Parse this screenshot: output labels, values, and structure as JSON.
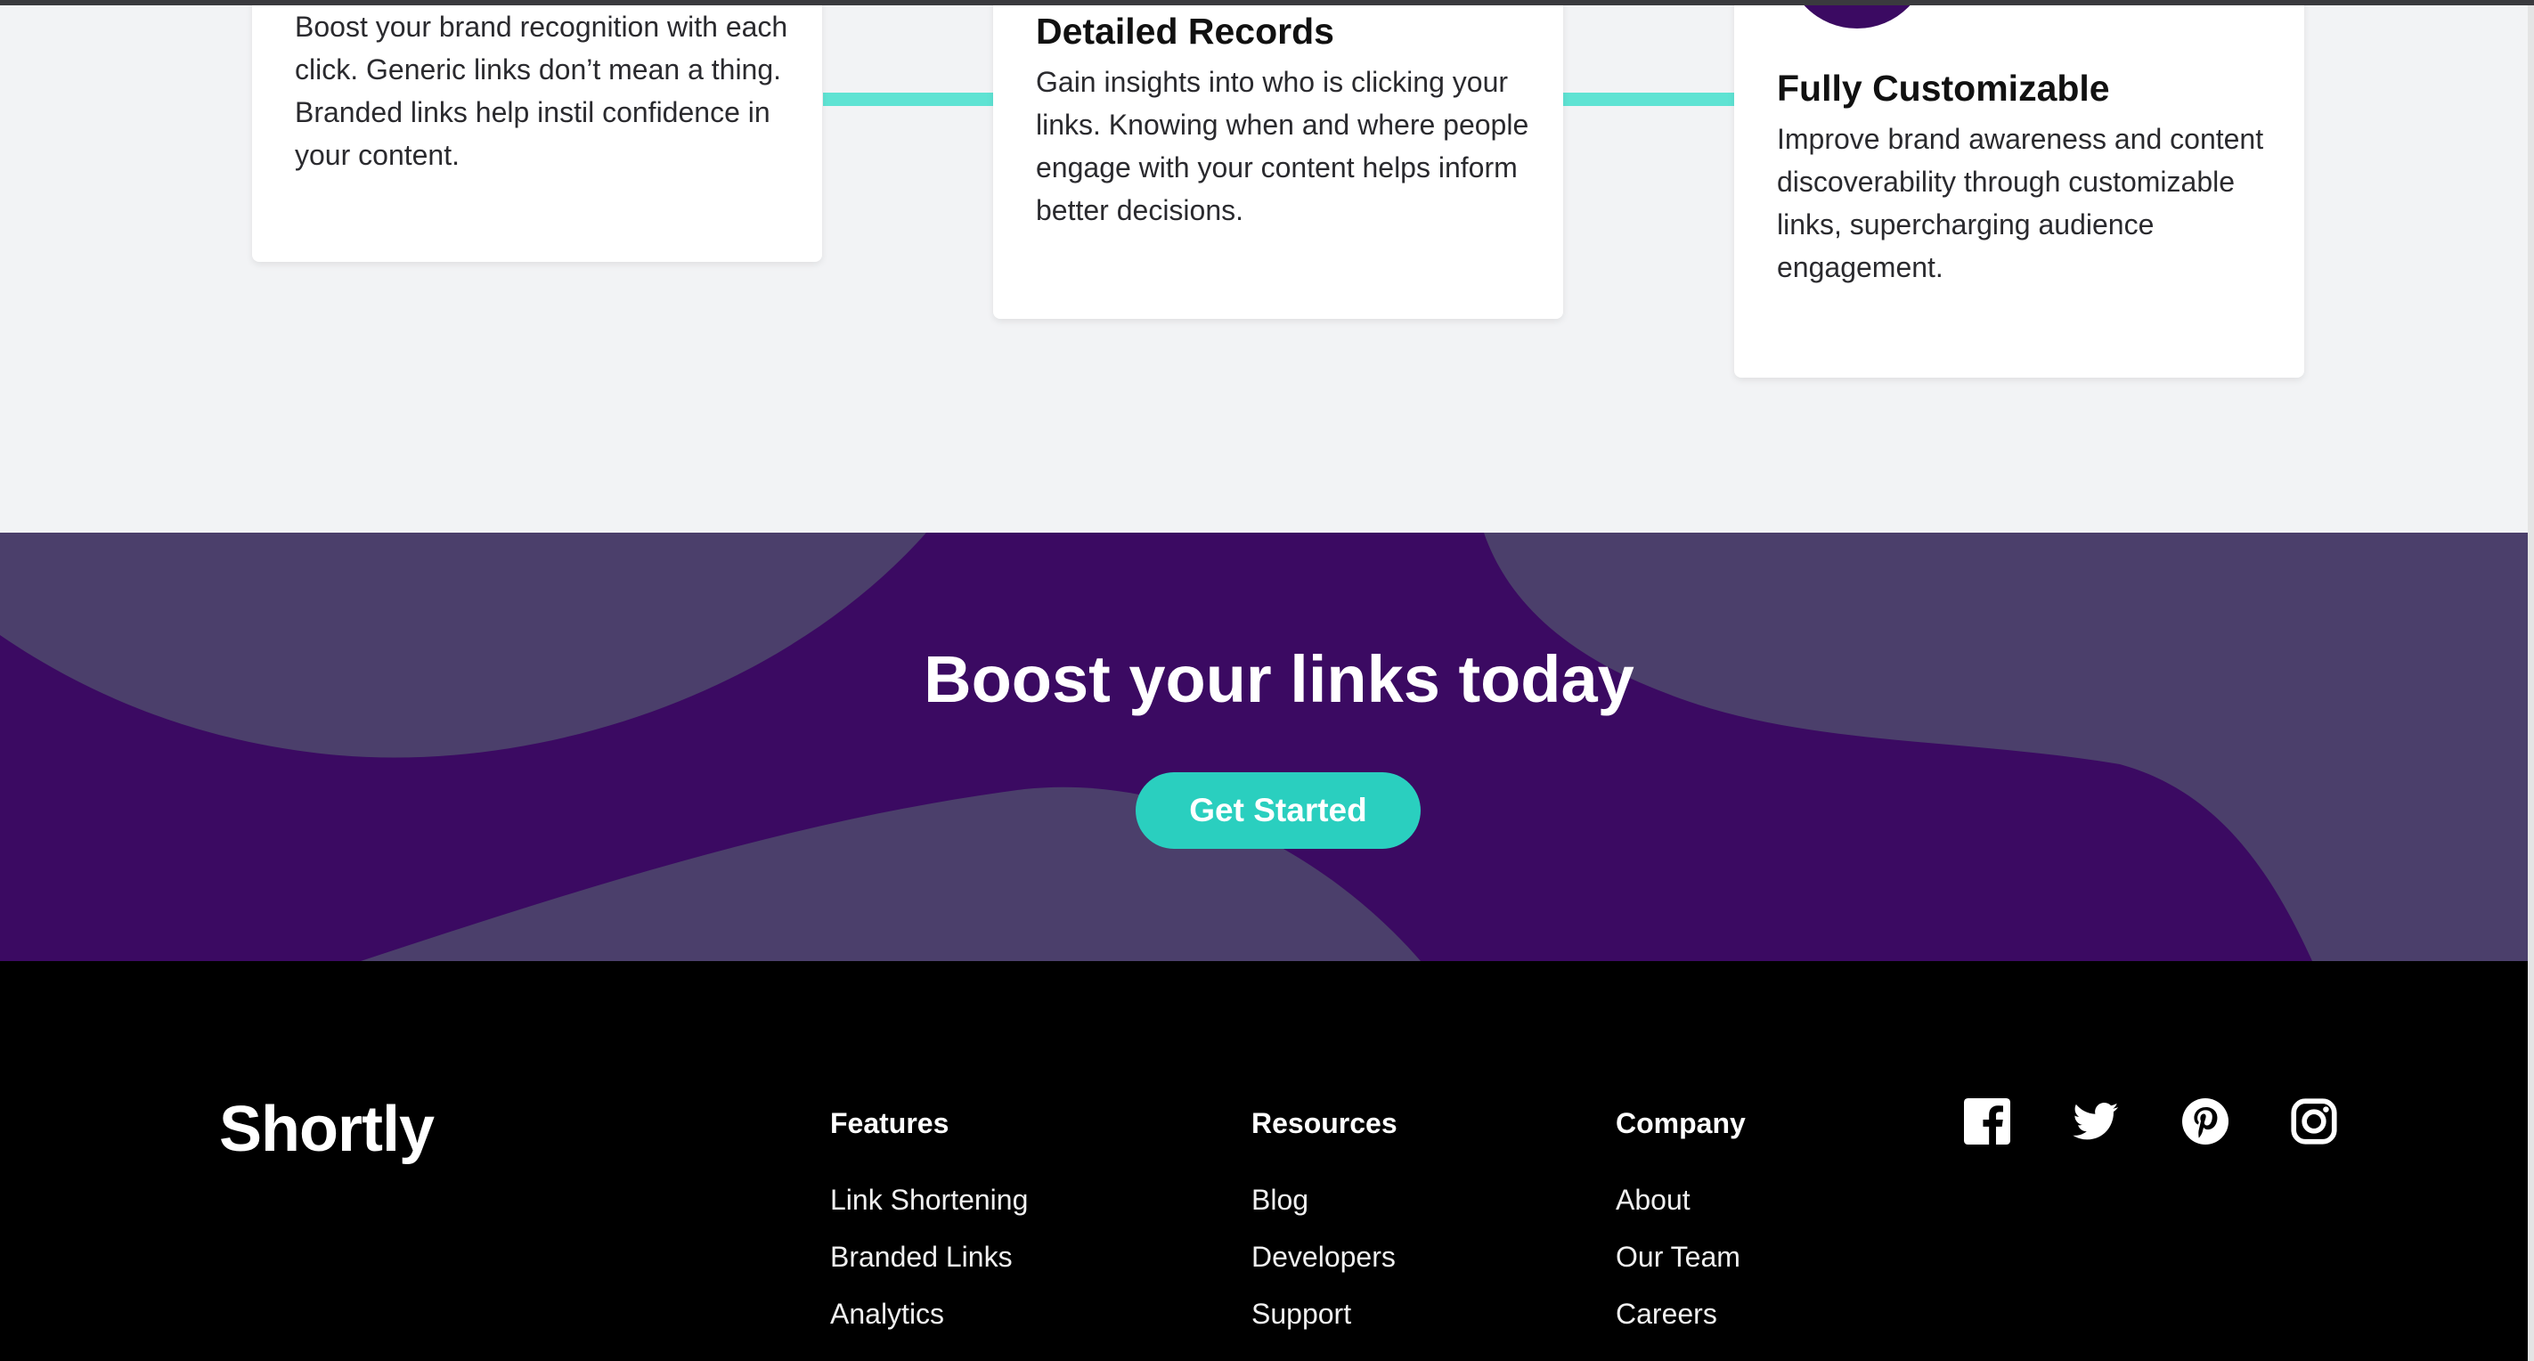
{
  "features": [
    {
      "title": "",
      "text": "Boost your brand recognition with each click. Generic links don’t mean a thing. Branded links help instil confidence in your content."
    },
    {
      "title": "Detailed Records",
      "text": "Gain insights into who is clicking your links. Knowing when and where people engage with your content helps inform better decisions."
    },
    {
      "title": "Fully Customizable",
      "text": "Improve brand awareness and content discoverability through customizable links, supercharging audience engagement."
    }
  ],
  "cta": {
    "title": "Boost your links today",
    "button_label": "Get Started"
  },
  "footer": {
    "logo": "Shortly",
    "columns": [
      {
        "heading": "Features",
        "links": [
          "Link Shortening",
          "Branded Links",
          "Analytics"
        ]
      },
      {
        "heading": "Resources",
        "links": [
          "Blog",
          "Developers",
          "Support"
        ]
      },
      {
        "heading": "Company",
        "links": [
          "About",
          "Our Team",
          "Careers"
        ]
      }
    ],
    "social_icons": [
      "facebook-icon",
      "twitter-icon",
      "pinterest-icon",
      "instagram-icon"
    ]
  },
  "colors": {
    "accent": "#2acfbf",
    "connector": "#5fe3d3",
    "dark_violet": "#3b0a62",
    "wave": "#4b3f6b",
    "footer_bg": "#000000",
    "section_bg": "#f2f3f5"
  }
}
